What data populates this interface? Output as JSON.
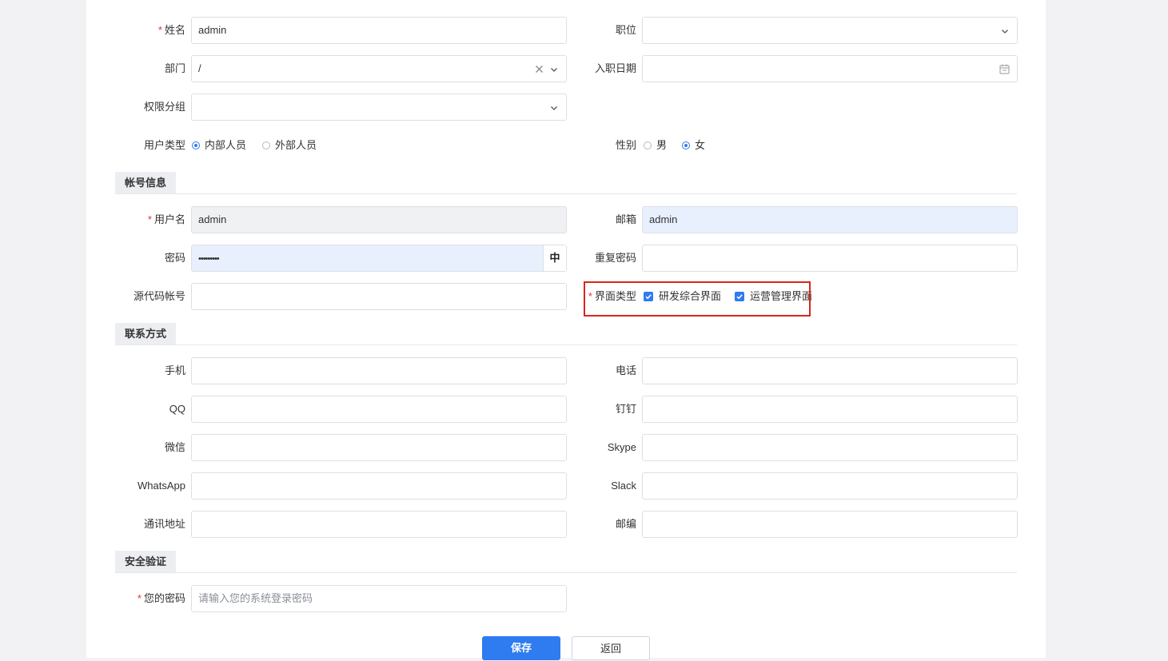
{
  "basic": {
    "name": {
      "label": "姓名",
      "value": "admin",
      "required": true
    },
    "position": {
      "label": "职位",
      "value": ""
    },
    "department": {
      "label": "部门",
      "value": "/"
    },
    "hire_date": {
      "label": "入职日期",
      "value": ""
    },
    "permission_group": {
      "label": "权限分组",
      "value": ""
    },
    "user_type": {
      "label": "用户类型",
      "options": [
        "内部人员",
        "外部人员"
      ],
      "selected": "内部人员"
    },
    "gender": {
      "label": "性别",
      "options": [
        "男",
        "女"
      ],
      "selected": "女"
    }
  },
  "account": {
    "section_title": "帐号信息",
    "username": {
      "label": "用户名",
      "value": "admin",
      "required": true
    },
    "email": {
      "label": "邮箱",
      "value": "admin"
    },
    "password": {
      "label": "密码",
      "value": "•••••••••",
      "ime_indicator": "中"
    },
    "repeat_password": {
      "label": "重复密码",
      "value": ""
    },
    "source_account": {
      "label": "源代码帐号",
      "value": ""
    },
    "ui_type": {
      "label": "界面类型",
      "required": true,
      "options": [
        "研发综合界面",
        "运营管理界面"
      ],
      "checked": [
        "研发综合界面",
        "运营管理界面"
      ]
    }
  },
  "contact": {
    "section_title": "联系方式",
    "mobile": {
      "label": "手机",
      "value": ""
    },
    "phone": {
      "label": "电话",
      "value": ""
    },
    "qq": {
      "label": "QQ",
      "value": ""
    },
    "dingtalk": {
      "label": "钉钉",
      "value": ""
    },
    "wechat": {
      "label": "微信",
      "value": ""
    },
    "skype": {
      "label": "Skype",
      "value": ""
    },
    "whatsapp": {
      "label": "WhatsApp",
      "value": ""
    },
    "slack": {
      "label": "Slack",
      "value": ""
    },
    "address": {
      "label": "通讯地址",
      "value": ""
    },
    "zipcode": {
      "label": "邮编",
      "value": ""
    }
  },
  "security": {
    "section_title": "安全验证",
    "your_password": {
      "label": "您的密码",
      "required": true,
      "placeholder": "请输入您的系统登录密码"
    }
  },
  "actions": {
    "save": "保存",
    "back": "返回"
  },
  "colors": {
    "primary": "#2f7bf0",
    "required": "#e0342f",
    "highlight_border": "#d9261c",
    "autofill_bg": "#e8f0fe"
  }
}
